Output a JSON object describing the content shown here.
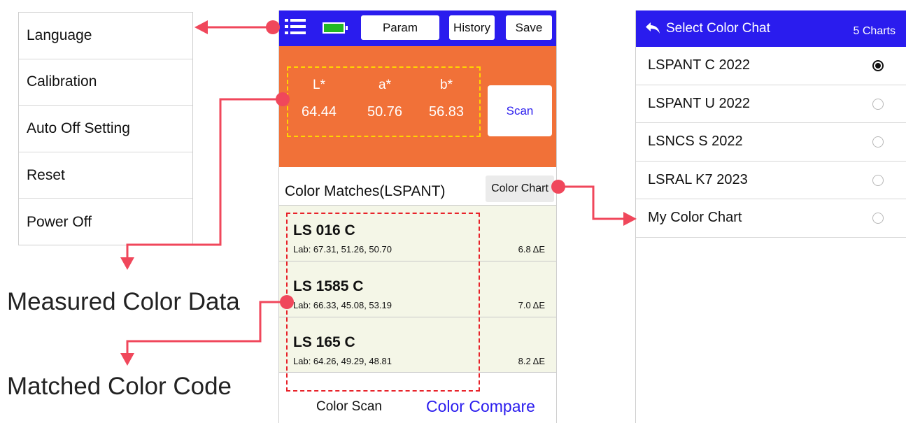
{
  "menu": {
    "items": [
      "Language",
      "Calibration",
      "Auto Off Setting",
      "Reset",
      "Power Off"
    ]
  },
  "phone": {
    "topbar": {
      "param_label": "Param",
      "history_label": "History",
      "save_label": "Save",
      "battery_color": "#22b822",
      "accent_color": "#2a1cee"
    },
    "measurement": {
      "l_label": "L*",
      "a_label": "a*",
      "b_label": "b*",
      "l_value": "64.44",
      "a_value": "50.76",
      "b_value": "56.83",
      "scan_label": "Scan",
      "panel_color": "#f17138"
    },
    "matches": {
      "title": "Color Matches(LSPANT)",
      "chart_button_label": "Color Chart",
      "rows": [
        {
          "code": "LS 016 C",
          "lab": "Lab: 67.31, 51.26, 50.70",
          "delta": "6.8 ΔE"
        },
        {
          "code": "LS 1585 C",
          "lab": "Lab: 66.33, 45.08, 53.19",
          "delta": "7.0 ΔE"
        },
        {
          "code": "LS 165 C",
          "lab": "Lab: 64.26, 49.29, 48.81",
          "delta": "8.2 ΔE"
        }
      ]
    },
    "tabs": {
      "scan_label": "Color Scan",
      "compare_label": "Color Compare"
    }
  },
  "selector": {
    "title": "Select Color Chat",
    "count": "5 Charts",
    "charts": [
      {
        "name": "LSPANT C 2022",
        "selected": true
      },
      {
        "name": "LSPANT U 2022",
        "selected": false
      },
      {
        "name": "LSNCS S 2022",
        "selected": false
      },
      {
        "name": "LSRAL K7 2023",
        "selected": false
      },
      {
        "name": "My Color Chart",
        "selected": false
      }
    ]
  },
  "callouts": {
    "measured": "Measured Color Data",
    "matched": "Matched Color Code",
    "arrow_color": "#f0475b"
  }
}
